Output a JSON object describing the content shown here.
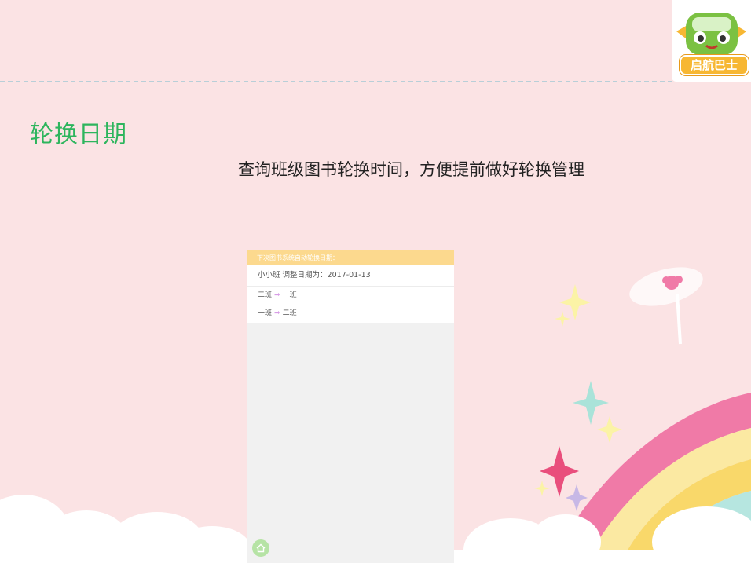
{
  "slide": {
    "title": "轮换日期",
    "subtitle": "查询班级图书轮换时间，方便提前做好轮换管理"
  },
  "logo": {
    "text": "启航巴士",
    "icon": "bus-mascot-icon"
  },
  "phone": {
    "header": "下次图书系统自动轮换日期：",
    "class_label": "小小班 调整日期为：2017-01-13",
    "rotations": [
      {
        "from": "二班",
        "to": "一班"
      },
      {
        "from": "一班",
        "to": "二班"
      }
    ],
    "home_icon": "home-icon"
  },
  "colors": {
    "title": "#2db55d",
    "background": "#fbe3e4",
    "header": "#fcd98e",
    "logo_badge": "#f7b733"
  }
}
